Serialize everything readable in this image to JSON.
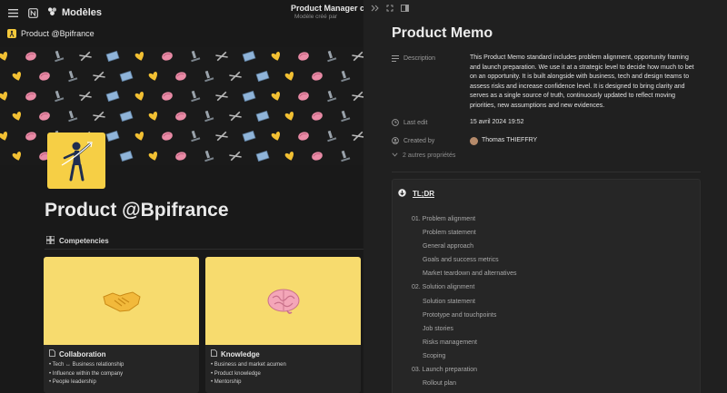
{
  "topbar": {
    "workspace": "Modèles",
    "doc_title": "Product Manager compe",
    "doc_subtitle": "Modèle créé par"
  },
  "page": {
    "breadcrumb": "Product @Bpifrance",
    "title": "Product @Bpifrance",
    "section_label": "Competencies"
  },
  "cards": [
    {
      "title": "Collaboration",
      "items": [
        "Tech ↔ Business relationship",
        "Influence within the company",
        "People leadership"
      ]
    },
    {
      "title": "Knowledge",
      "items": [
        "Business and market acumen",
        "Product knowledge",
        "Mentorship"
      ]
    }
  ],
  "memo": {
    "title": "Product Memo",
    "description_label": "Description",
    "description": "This Product Memo standard includes problem alignment, opportunity framing and launch preparation. We use it at a strategic level to decide how much to bet on an opportunity. It is built alongside with business, tech and design teams to assess risks and increase confidence level. It is designed to bring clarity and serves as a single source of truth, continuously updated to reflect moving priorities, new assumptions and new evidences.",
    "last_edit_label": "Last edit",
    "last_edit": "15 avril 2024 19:52",
    "created_by_label": "Created by",
    "created_by": "Thomas THIEFFRY",
    "more_props": "2 autres propriétés",
    "tldr_label": "TL;DR",
    "toc": [
      {
        "text": "01. Problem alignment",
        "level": 0
      },
      {
        "text": "Problem statement",
        "level": 1
      },
      {
        "text": "General approach",
        "level": 1
      },
      {
        "text": "Goals and success metrics",
        "level": 1
      },
      {
        "text": "Market teardown and alternatives",
        "level": 1
      },
      {
        "text": "02. Solution alignment",
        "level": 0
      },
      {
        "text": "Solution statement",
        "level": 1
      },
      {
        "text": "Prototype and touchpoints",
        "level": 1
      },
      {
        "text": "Job stories",
        "level": 1
      },
      {
        "text": "Risks management",
        "level": 1
      },
      {
        "text": "Scoping",
        "level": 1
      },
      {
        "text": "03. Launch preparation",
        "level": 0
      },
      {
        "text": "Rollout plan",
        "level": 1
      }
    ]
  },
  "colors": {
    "accent_yellow": "#f6cf45",
    "card_yellow": "#f7db6e",
    "background": "#191919",
    "panel": "#202020"
  }
}
